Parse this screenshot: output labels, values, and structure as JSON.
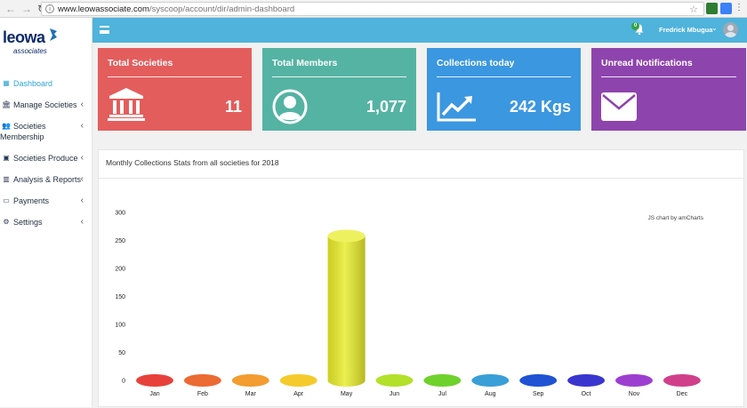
{
  "browser": {
    "url_host": "www.leowassociate.com",
    "url_path": "/syscoop/account/dir/admin-dashboard"
  },
  "brand": {
    "logo_word": "leowa",
    "logo_sub": "associates"
  },
  "sidebar": {
    "items": [
      {
        "label": "Dashboard",
        "icon": "dashboard-icon",
        "active": true,
        "caret": ""
      },
      {
        "label": "Manage Societies",
        "icon": "bank-icon",
        "active": false,
        "caret": "‹"
      },
      {
        "label_1": "Societies",
        "label_2": "Membership",
        "icon": "users-icon",
        "active": false,
        "caret": "‹"
      },
      {
        "label": "Societies Produce",
        "icon": "id-card-icon",
        "active": false,
        "caret": "‹"
      },
      {
        "label": "Analysis & Reports",
        "icon": "bar-chart-icon",
        "active": false,
        "caret": "‹"
      },
      {
        "label": "Payments",
        "icon": "money-icon",
        "active": false,
        "caret": "‹"
      },
      {
        "label": "Settings",
        "icon": "cogs-icon",
        "active": false,
        "caret": "‹"
      }
    ]
  },
  "topbar": {
    "notification_count": "0",
    "user_name": "Fredrick Mbugua",
    "user_caret": "⌄"
  },
  "cards": [
    {
      "title": "Total Societies",
      "value": "11",
      "color": "#e45d5d",
      "icon": "bank-icon"
    },
    {
      "title": "Total Members",
      "value": "1,077",
      "color": "#55b3a3",
      "icon": "user-circle-icon"
    },
    {
      "title": "Collections today",
      "value": "242 Kgs",
      "color": "#3b97e0",
      "icon": "line-chart-icon"
    },
    {
      "title": "Unread Notifications",
      "value": "",
      "color": "#8e44ad",
      "icon": "envelope-icon"
    }
  ],
  "panel": {
    "title": "Monthly Collections Stats from all societies for 2018",
    "credit": "JS chart by amCharts"
  },
  "chart_data": {
    "type": "bar",
    "categories": [
      "Jan",
      "Feb",
      "Mar",
      "Apr",
      "May",
      "Jun",
      "Jul",
      "Aug",
      "Sep",
      "Oct",
      "Nov",
      "Dec"
    ],
    "values": [
      0,
      0,
      0,
      0,
      258,
      0,
      0,
      0,
      0,
      0,
      0,
      0
    ],
    "colors": [
      "#e8413b",
      "#ec6a33",
      "#f39c2f",
      "#f5ca2c",
      "#e8ec2a",
      "#b3e02a",
      "#6fd12c",
      "#3a9fd6",
      "#1f53d4",
      "#3b35cf",
      "#9c3fd0",
      "#d0408a"
    ],
    "yticks": [
      0,
      50,
      100,
      150,
      200,
      250,
      300
    ],
    "ylim": [
      0,
      300
    ],
    "title": "",
    "xlabel": "",
    "ylabel": "",
    "grid": false,
    "style": "3d-cylinder"
  }
}
